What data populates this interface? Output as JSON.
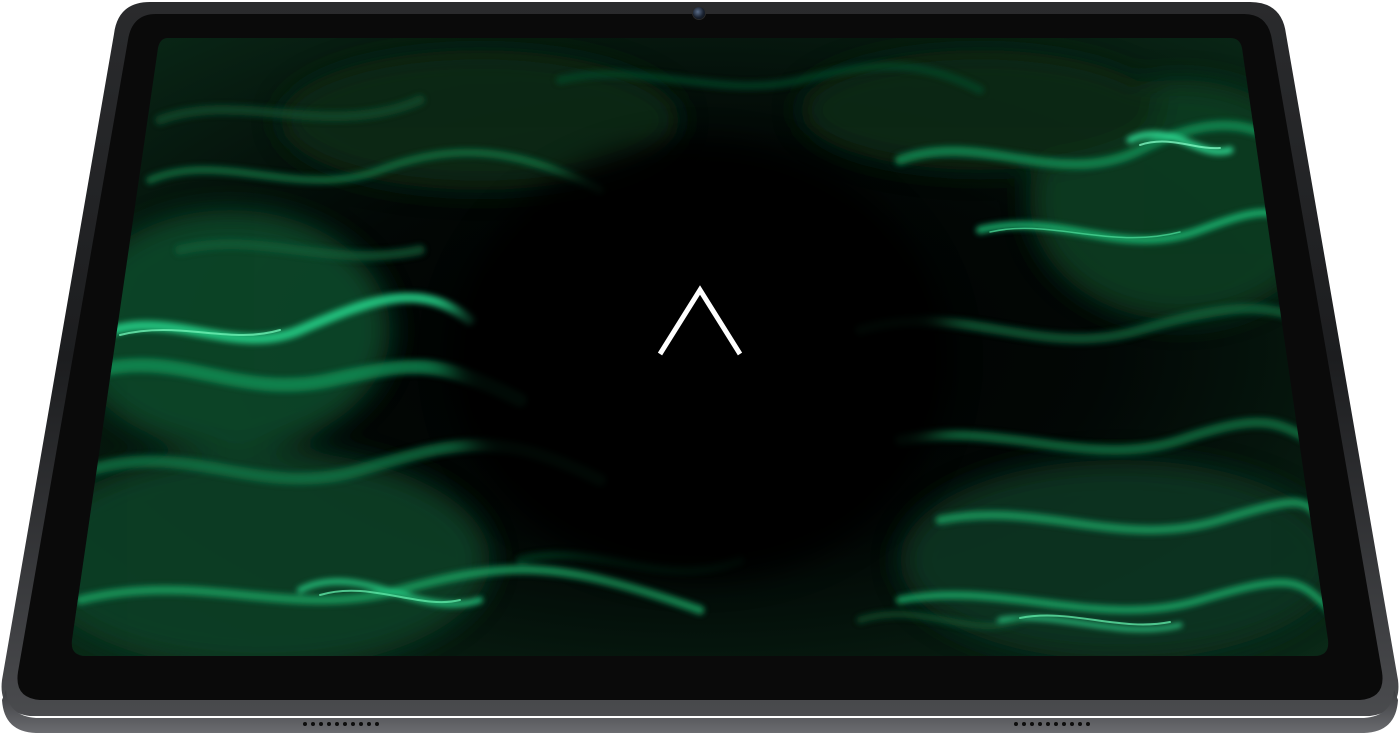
{
  "device": {
    "type": "tablet",
    "frame_color": "#3a3b3d",
    "bezel_color": "#0b0b0b",
    "wallpaper": {
      "description_colors": {
        "base": "#020604",
        "mid": "#0b3a22",
        "highlight": "#22c77a"
      }
    },
    "logo_icon": "chevron-up-logo-icon",
    "camera_icon": "front-camera-icon",
    "speaker_icon": "speaker-grille-icon"
  }
}
